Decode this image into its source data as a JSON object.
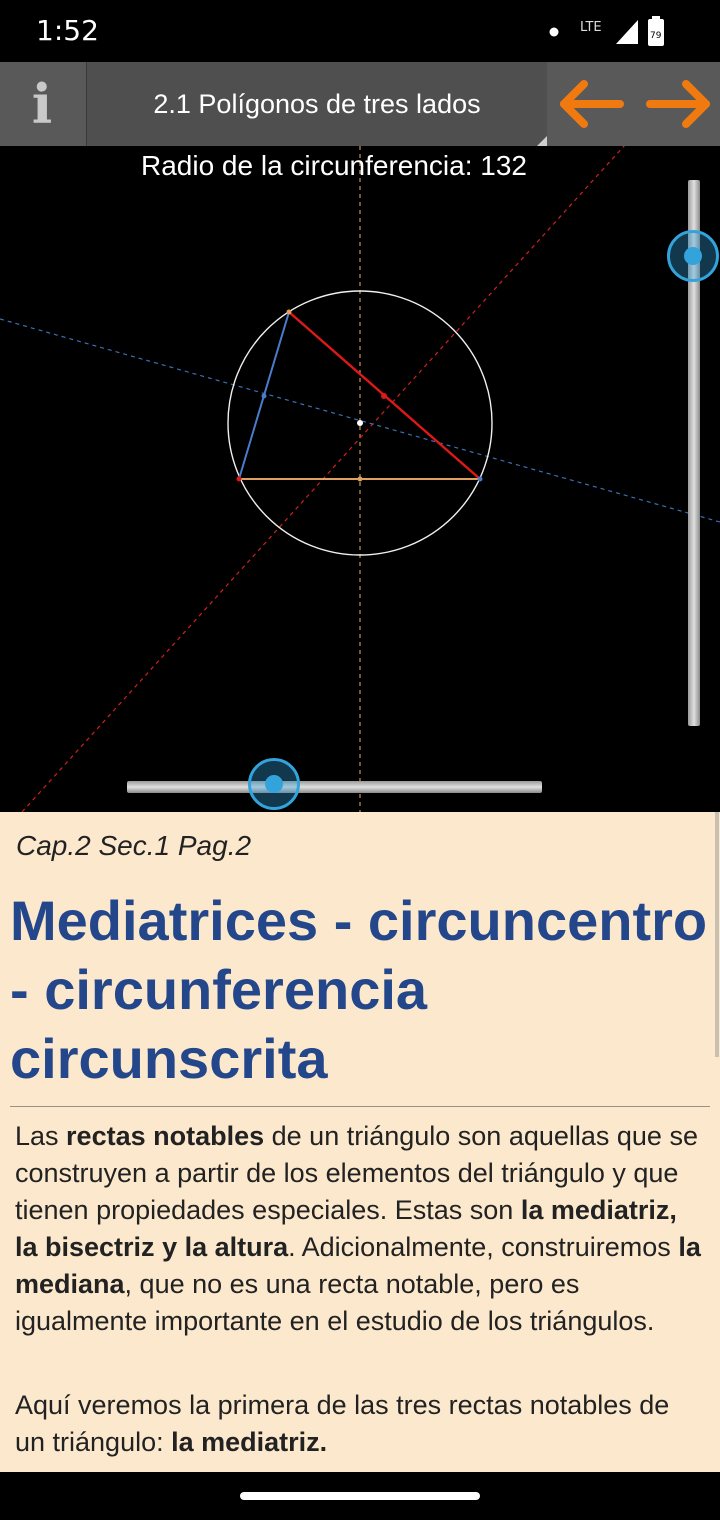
{
  "status_bar": {
    "time": "1:52",
    "network": "LTE",
    "battery": "79"
  },
  "toolbar": {
    "title": "2.1 Polígonos de tres lados"
  },
  "canvas": {
    "radius_label": "Radio de la circunferencia: 132"
  },
  "content": {
    "breadcrumb": "Cap.2 Sec.1 Pag.2",
    "heading": "Mediatrices - circuncentro - circunferencia circunscrita",
    "para1": {
      "t1": "Las ",
      "b1": "rectas notables",
      "t2": " de un triángulo son aquellas que se construyen a partir de los elementos del triángulo y que tienen propiedades especiales. Estas son ",
      "b2": "la mediatriz, la bisectriz y la altura",
      "t3": ". Adicionalmente, construiremos ",
      "b3": "la mediana",
      "t4": ", que no es una recta notable, pero es igualmente importante en el estudio de los triángulos."
    },
    "para2": {
      "t1": "Aquí veremos la primera de las tres rectas notables de un triángulo: ",
      "b1": "la mediatriz."
    }
  },
  "colors": {
    "accent_orange": "#f07a10",
    "heading_blue": "#23478a",
    "slider_blue": "#33a3dc",
    "content_bg": "#fce9cd"
  }
}
